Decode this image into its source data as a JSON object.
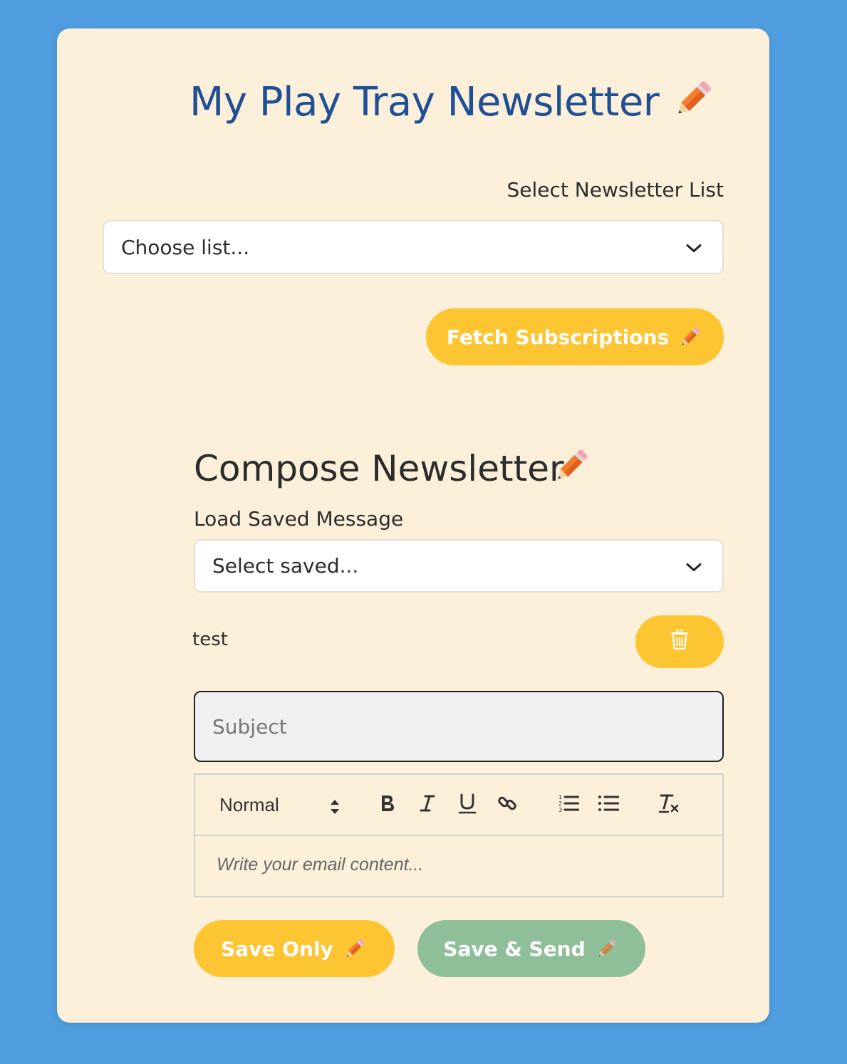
{
  "app": {
    "title": "My Play Tray Newsletter",
    "title_icon": "pencil-icon"
  },
  "list_section": {
    "label": "Select Newsletter List",
    "select_value": "Choose list...",
    "fetch_button": "Fetch Subscriptions",
    "fetch_icon": "pencil-icon"
  },
  "compose": {
    "title": "Compose Newsletter",
    "title_icon": "pencil-icon",
    "load_label": "Load Saved Message",
    "saved_select_value": "Select saved...",
    "saved_item_name": "test",
    "delete_icon": "trash-icon",
    "subject_placeholder": "Subject",
    "subject_value": "",
    "editor": {
      "heading_value": "Normal",
      "tools": [
        "bold-icon",
        "italic-icon",
        "underline-icon",
        "link-icon",
        "ordered-list-icon",
        "bullet-list-icon",
        "clear-format-icon"
      ],
      "placeholder": "Write your email content..."
    },
    "save_only_button": "Save Only",
    "save_send_button": "Save & Send"
  },
  "colors": {
    "page_background": "#4f9dde",
    "card_background": "#fdf0da",
    "title_color": "#1f4f94",
    "primary_button": "#fec532",
    "secondary_button": "#8fbf98"
  }
}
